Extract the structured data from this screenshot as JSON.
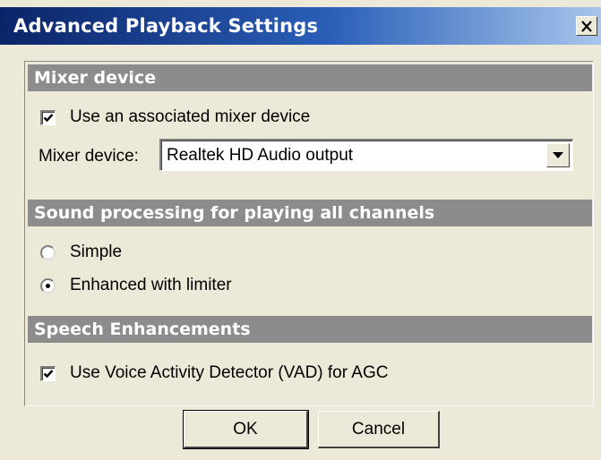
{
  "window": {
    "title": "Advanced Playback Settings",
    "close_label": "X"
  },
  "sections": {
    "mixer": {
      "header": "Mixer device",
      "use_mixer_checkbox": {
        "label": "Use an associated mixer device",
        "checked": true
      },
      "mixer_device_label": "Mixer device:",
      "mixer_device_value": "Realtek HD Audio output"
    },
    "sound_processing": {
      "header": "Sound processing for playing all channels",
      "options": [
        {
          "label": "Simple",
          "selected": false
        },
        {
          "label": "Enhanced with limiter",
          "selected": true
        }
      ]
    },
    "speech": {
      "header": "Speech Enhancements",
      "vad_checkbox": {
        "label": "Use Voice Activity Detector (VAD) for AGC",
        "checked": true
      }
    }
  },
  "buttons": {
    "ok": "OK",
    "cancel": "Cancel"
  }
}
